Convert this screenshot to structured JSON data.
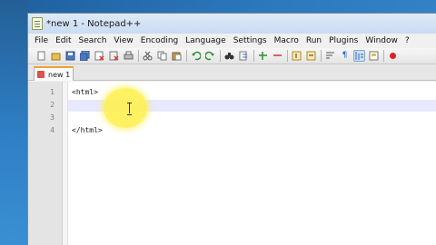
{
  "window": {
    "title": "*new 1 - Notepad++"
  },
  "menu": {
    "items": [
      "File",
      "Edit",
      "Search",
      "View",
      "Encoding",
      "Language",
      "Settings",
      "Macro",
      "Run",
      "Plugins",
      "Window",
      "?"
    ]
  },
  "toolbar": {
    "buttons": [
      "new-file-icon",
      "open-file-icon",
      "save-icon",
      "save-all-icon",
      "close-icon",
      "close-all-icon",
      "print-icon",
      "cut-icon",
      "copy-icon",
      "paste-icon",
      "undo-icon",
      "redo-icon",
      "find-icon",
      "replace-icon",
      "zoom-in-icon",
      "zoom-out-icon",
      "sync-vertical-icon",
      "sync-horizontal-icon",
      "word-wrap-icon",
      "show-all-chars-icon",
      "indent-guide-icon",
      "document-map-icon",
      "record-macro-icon"
    ]
  },
  "tabs": [
    {
      "label": "new 1",
      "state": "unsaved"
    }
  ],
  "editor": {
    "lines": [
      {
        "number": "1",
        "text": "<html>"
      },
      {
        "number": "2",
        "text": ""
      },
      {
        "number": "3",
        "text": ""
      },
      {
        "number": "4",
        "text": "</html>"
      }
    ],
    "current_line": 2
  },
  "colors": {
    "current_line_bg": "#e8e8ff",
    "cursor_highlight": "#fff046",
    "tab_accent": "#f0a030"
  }
}
